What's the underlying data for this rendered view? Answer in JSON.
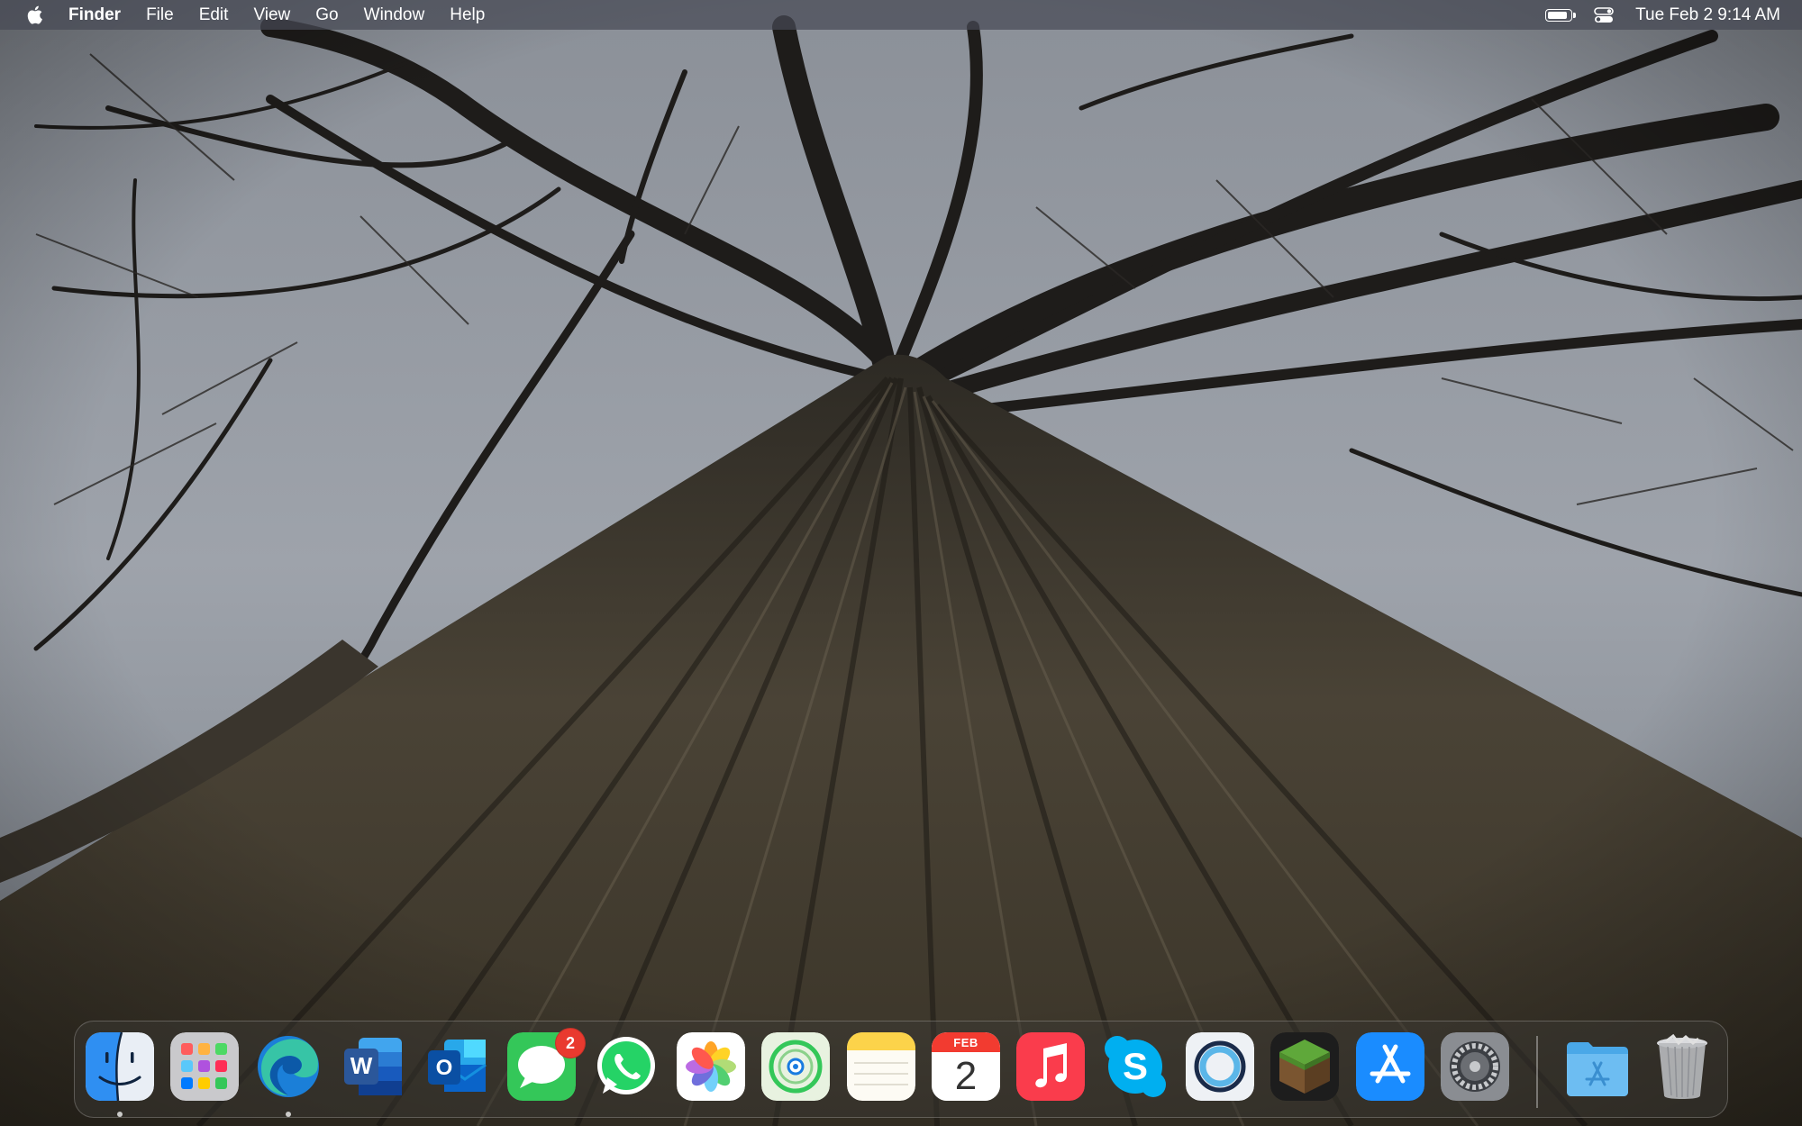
{
  "menubar": {
    "apple_icon": "apple-logo-icon",
    "items": [
      "Finder",
      "File",
      "Edit",
      "View",
      "Go",
      "Window",
      "Help"
    ],
    "battery_level": 0.9,
    "clock": "Tue Feb 2  9:14 AM"
  },
  "wallpaper": {
    "subject": "tree-trunk-looking-up"
  },
  "dock": {
    "apps": [
      {
        "name": "Finder",
        "icon": "finder-icon",
        "running": true
      },
      {
        "name": "Launchpad",
        "icon": "launchpad-icon",
        "running": false
      },
      {
        "name": "Microsoft Edge",
        "icon": "edge-icon",
        "running": true
      },
      {
        "name": "Microsoft Word",
        "icon": "word-icon",
        "running": false
      },
      {
        "name": "Microsoft Outlook",
        "icon": "outlook-icon",
        "running": false
      },
      {
        "name": "Messages",
        "icon": "messages-icon",
        "running": false,
        "badge": "2"
      },
      {
        "name": "WhatsApp",
        "icon": "whatsapp-icon",
        "running": false
      },
      {
        "name": "Photos",
        "icon": "photos-icon",
        "running": false
      },
      {
        "name": "Find My",
        "icon": "find-my-icon",
        "running": false
      },
      {
        "name": "Notes",
        "icon": "notes-icon",
        "running": false
      },
      {
        "name": "Calendar",
        "icon": "calendar-icon",
        "running": false,
        "month": "FEB",
        "day": "2"
      },
      {
        "name": "Music",
        "icon": "music-icon",
        "running": false
      },
      {
        "name": "Skype",
        "icon": "skype-icon",
        "running": false
      },
      {
        "name": "Alexa",
        "icon": "alexa-icon",
        "running": false
      },
      {
        "name": "Minecraft",
        "icon": "minecraft-icon",
        "running": false
      },
      {
        "name": "App Store",
        "icon": "app-store-icon",
        "running": false
      },
      {
        "name": "System Preferences",
        "icon": "system-preferences-icon",
        "running": false
      }
    ],
    "folders": [
      {
        "name": "Applications",
        "icon": "applications-folder-icon"
      },
      {
        "name": "Trash",
        "icon": "trash-icon"
      }
    ],
    "colors": {
      "badge": "#e93a2f",
      "word": "#2b579a",
      "outlook": "#0a64c9",
      "messages": "#34c759",
      "whatsapp": "#25d366",
      "music": "#fa3c4c",
      "skype": "#00aff0",
      "app_store": "#1a8cff"
    }
  }
}
